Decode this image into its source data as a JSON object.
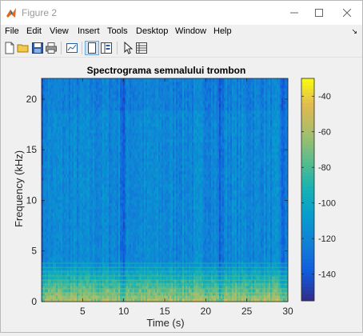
{
  "window": {
    "title": "Figure 2"
  },
  "menu": {
    "items": [
      "File",
      "Edit",
      "View",
      "Insert",
      "Tools",
      "Desktop",
      "Window",
      "Help"
    ]
  },
  "toolbar": {
    "icons": [
      "new-figure-icon",
      "open-file-icon",
      "save-icon",
      "print-icon",
      "link-plot-icon",
      "hide-plot-tools-icon",
      "show-plot-tools-icon",
      "edit-plot-arrow-icon",
      "property-inspector-icon"
    ]
  },
  "colors": {
    "accent": "#0072bd",
    "colormap": "parula"
  },
  "chart_data": {
    "type": "heatmap",
    "title": "Spectrograma semnalului trombon",
    "xlabel": "Time (s)",
    "ylabel": "Frequency (kHz)",
    "xlim": [
      0,
      30
    ],
    "ylim": [
      0,
      22.05
    ],
    "xticks": [
      5,
      10,
      15,
      20,
      25,
      30
    ],
    "yticks": [
      0,
      5,
      10,
      15,
      20
    ],
    "colorbar": {
      "clim": [
        -155,
        -30
      ],
      "ticks": [
        -40,
        -60,
        -80,
        -100,
        -120,
        -140
      ]
    },
    "pauses_s": [
      0,
      10,
      21.8,
      29.5
    ],
    "energy_band_khz": [
      0,
      4
    ],
    "background_level_db": -118
  }
}
